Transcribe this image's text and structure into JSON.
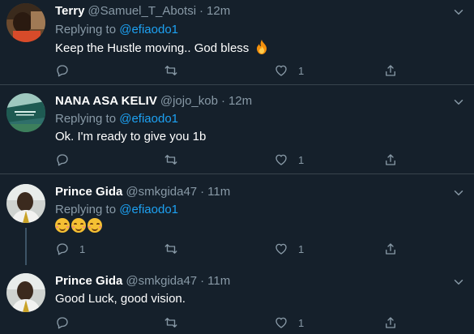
{
  "tweets": [
    {
      "name": "Terry",
      "handle": "@Samuel_T_Abotsi",
      "separator": "·",
      "time": "12m",
      "replying_prefix": "Replying to ",
      "replying_to": "@efiaodo1",
      "text": "Keep the Hustle moving.. God bless",
      "emoji": "fire-emoji",
      "reply_count": "",
      "retweet_count": "",
      "like_count": "1"
    },
    {
      "name": "NANA ASA KELIV",
      "handle": "@jojo_kob",
      "separator": "·",
      "time": "12m",
      "replying_prefix": "Replying to ",
      "replying_to": "@efiaodo1",
      "text": "Ok. I'm ready to give you 1b",
      "reply_count": "",
      "retweet_count": "",
      "like_count": "1"
    },
    {
      "name": "Prince Gida",
      "handle": "@smkgida47",
      "separator": "·",
      "time": "11m",
      "replying_prefix": "Replying to ",
      "replying_to": "@efiaodo1",
      "emoji": "smiling-face-with-blush-emoji x3",
      "reply_count": "1",
      "retweet_count": "",
      "like_count": "1"
    },
    {
      "name": "Prince Gida",
      "handle": "@smkgida47",
      "separator": "·",
      "time": "11m",
      "text": "Good Luck, good vision.",
      "reply_count": "",
      "retweet_count": "",
      "like_count": "1"
    }
  ],
  "colors": {
    "background": "#15202b",
    "divider": "#38444d",
    "secondary_text": "#8899a6",
    "link": "#1da1f2",
    "thread_line": "#3d5466"
  },
  "icons": [
    "reply-icon",
    "retweet-icon",
    "like-icon",
    "share-icon",
    "chevron-down-icon"
  ]
}
